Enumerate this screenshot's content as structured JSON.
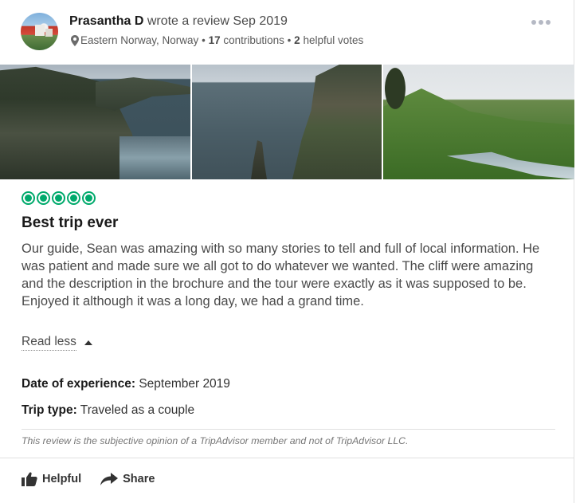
{
  "review": {
    "author": {
      "name": "Prasantha D",
      "action_text": "wrote a review Sep 2019",
      "location": "Eastern Norway, Norway",
      "contributions_count": "17",
      "contributions_label": "contributions",
      "helpful_votes_count": "2",
      "helpful_votes_label": "helpful votes",
      "separator": "•"
    },
    "rating": {
      "value": 5,
      "max": 5,
      "color": "#00aa6c"
    },
    "title": "Best trip ever",
    "text": "Our guide, Sean was amazing with so many stories to tell and full of local information. He was patient and made sure we all got to do whatever we wanted. The cliff were amazing and the description in the brochure and the tour were exactly as it was supposed to be. Enjoyed it although it was a long day, we had a grand time.",
    "read_less_label": "Read less",
    "date_of_experience": {
      "label": "Date of experience:",
      "value": "September 2019"
    },
    "trip_type": {
      "label": "Trip type:",
      "value": "Traveled as a couple"
    },
    "disclaimer": "This review is the subjective opinion of a TripAdvisor member and not of TripAdvisor LLC.",
    "photos": [
      {
        "icon": "sea-cliffs-photo"
      },
      {
        "icon": "sea-stack-photo"
      },
      {
        "icon": "valley-river-photo"
      }
    ]
  },
  "actions": {
    "helpful_label": "Helpful",
    "share_label": "Share",
    "helpful_icon": "thumbs-up-icon",
    "share_icon": "share-arrow-icon"
  },
  "icons": {
    "location": "map-pin-icon",
    "more": "more-options-icon"
  }
}
